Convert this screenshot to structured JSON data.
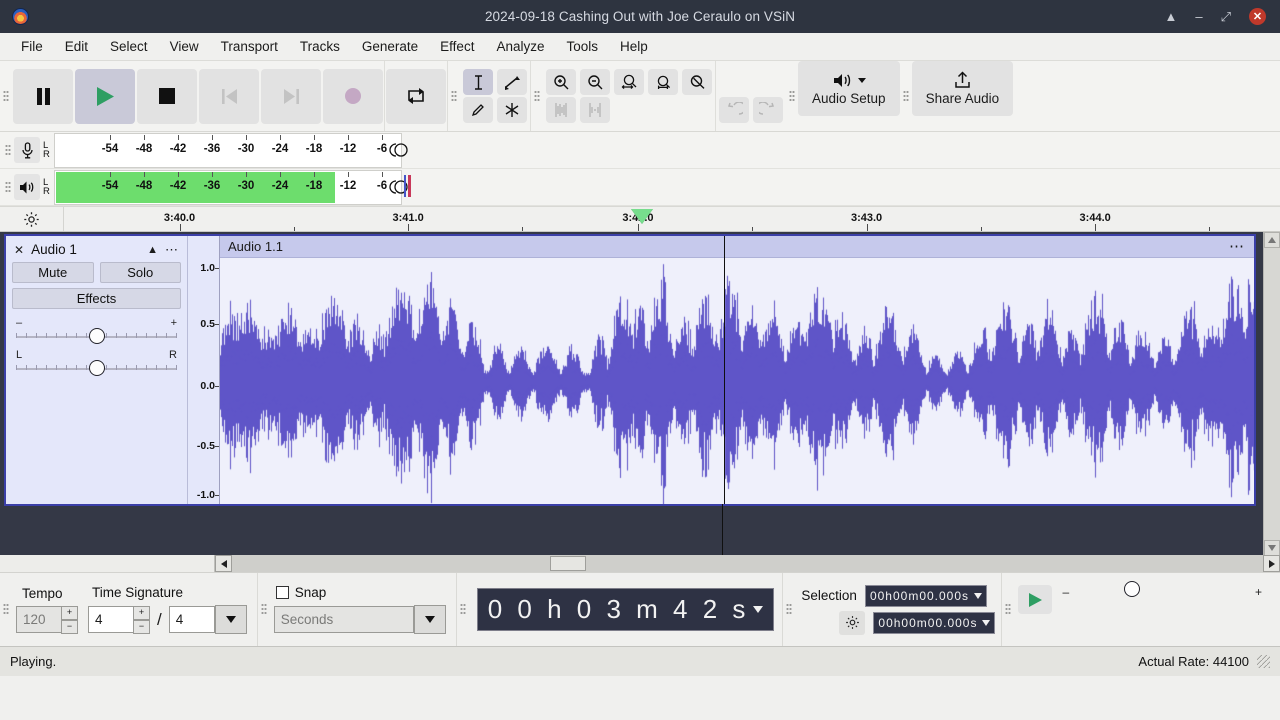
{
  "window": {
    "title": "2024-09-18 Cashing Out with Joe Ceraulo on VSiN",
    "logo_icon": "audacity-logo-icon",
    "controls": {
      "restore_down": "⏶",
      "minimize": "–",
      "maximize": "⤢",
      "close": "✕"
    }
  },
  "menubar": {
    "items": [
      {
        "label": "File"
      },
      {
        "label": "Edit"
      },
      {
        "label": "Select"
      },
      {
        "label": "View"
      },
      {
        "label": "Transport"
      },
      {
        "label": "Tracks"
      },
      {
        "label": "Generate"
      },
      {
        "label": "Effect"
      },
      {
        "label": "Analyze"
      },
      {
        "label": "Tools"
      },
      {
        "label": "Help"
      }
    ]
  },
  "transport": {
    "buttons": [
      {
        "name": "pause",
        "icon": "pause-icon",
        "state": "enabled"
      },
      {
        "name": "play",
        "icon": "play-icon",
        "state": "active"
      },
      {
        "name": "stop",
        "icon": "stop-icon",
        "state": "enabled"
      },
      {
        "name": "skip-to-start",
        "icon": "skip-start-icon",
        "state": "disabled"
      },
      {
        "name": "skip-to-end",
        "icon": "skip-end-icon",
        "state": "disabled"
      },
      {
        "name": "record",
        "icon": "record-icon",
        "state": "enabled"
      },
      {
        "name": "loop",
        "icon": "loop-icon",
        "state": "enabled"
      }
    ]
  },
  "tools": {
    "row1": [
      {
        "name": "selection-tool",
        "icon": "i-beam-icon",
        "state": "active"
      },
      {
        "name": "envelope-tool",
        "icon": "envelope-icon",
        "state": "enabled"
      }
    ],
    "row2": [
      {
        "name": "draw-tool",
        "icon": "pencil-icon",
        "state": "enabled"
      },
      {
        "name": "multi-tool",
        "icon": "asterisk-icon",
        "state": "enabled"
      }
    ]
  },
  "zoom_tools": [
    {
      "name": "zoom-in",
      "icon": "zoom-in-icon"
    },
    {
      "name": "zoom-out",
      "icon": "zoom-out-icon"
    },
    {
      "name": "fit-selection",
      "icon": "fit-selection-icon"
    },
    {
      "name": "fit-project",
      "icon": "fit-project-icon"
    },
    {
      "name": "zoom-toggle",
      "icon": "zoom-toggle-icon"
    }
  ],
  "edit_tools": [
    {
      "name": "trim-audio",
      "icon": "trim-icon",
      "state": "disabled"
    },
    {
      "name": "silence-audio",
      "icon": "silence-icon",
      "state": "disabled"
    },
    {
      "name": "undo",
      "icon": "undo-icon",
      "state": "disabled"
    },
    {
      "name": "redo",
      "icon": "redo-icon",
      "state": "disabled"
    }
  ],
  "audio_setup": {
    "label": "Audio Setup",
    "icon": "speaker-icon"
  },
  "share_audio": {
    "label": "Share Audio",
    "icon": "upload-icon"
  },
  "meters": {
    "record": {
      "icon": "microphone-icon",
      "channels": [
        "L",
        "R"
      ],
      "scale": [
        "-54",
        "-48",
        "-42",
        "-36",
        "-30",
        "-24",
        "-18",
        "-12",
        "-6"
      ],
      "level_db": null,
      "fill_percent": 0
    },
    "playback": {
      "icon": "speaker-icon",
      "channels": [
        "L",
        "R"
      ],
      "scale": [
        "-54",
        "-48",
        "-42",
        "-36",
        "-30",
        "-24",
        "-18",
        "-12",
        "-6"
      ],
      "level_db": -12,
      "fill_percent": 80.5,
      "fill_color": "#6ddd6d"
    }
  },
  "timeline": {
    "settings_icon": "gear-icon",
    "labels": [
      {
        "text": "3:40.0",
        "pos_pct": 9.5
      },
      {
        "text": "3:41.0",
        "pos_pct": 28.3
      },
      {
        "text": "3:42.0",
        "pos_pct": 47.2
      },
      {
        "text": "3:43.0",
        "pos_pct": 66.0
      },
      {
        "text": "3:44.0",
        "pos_pct": 84.8
      }
    ],
    "playhead_pos_pct": 47.5,
    "playhead_color": "#77dd8d"
  },
  "track": {
    "name": "Audio 1",
    "close_icon": "close-icon",
    "collapse_icon": "chevron-up-icon",
    "menu_icon": "ellipsis-icon",
    "mute_label": "Mute",
    "solo_label": "Solo",
    "effects_label": "Effects",
    "gain": {
      "min_label": "–",
      "max_label": "+",
      "value_pct": 50
    },
    "pan": {
      "min_label": "L",
      "max_label": "R",
      "value_pct": 50
    },
    "vertical_ruler": [
      "1.0",
      "0.5",
      "0.0",
      "-0.5",
      "-1.0"
    ],
    "clip": {
      "name": "Audio 1.1",
      "menu_icon": "ellipsis-icon",
      "waveform_color": "#5f55c8",
      "background_color": "#eff0fb"
    },
    "cursor_pos_pct": 48.7
  },
  "bottom": {
    "tempo": {
      "label": "Tempo",
      "value": "120",
      "enabled": false
    },
    "time_signature": {
      "label": "Time Signature",
      "upper": "4",
      "lower": "4",
      "separator": "/"
    },
    "snap": {
      "label": "Snap",
      "checked": false,
      "mode": "Seconds",
      "enabled": false
    },
    "audio_position": {
      "value": "00h03m42s",
      "digits": "0 0 h 0 3 m 4 2 s"
    },
    "selection": {
      "label": "Selection",
      "settings_icon": "gear-icon",
      "start": "00h00m00.000s",
      "end": "00h00m00.000s"
    },
    "play_speed": {
      "icon": "play-icon",
      "min_label": "–",
      "max_label": "+",
      "value_pct": 35
    }
  },
  "statusbar": {
    "message": "Playing.",
    "rate_label": "Actual Rate: 44100"
  }
}
